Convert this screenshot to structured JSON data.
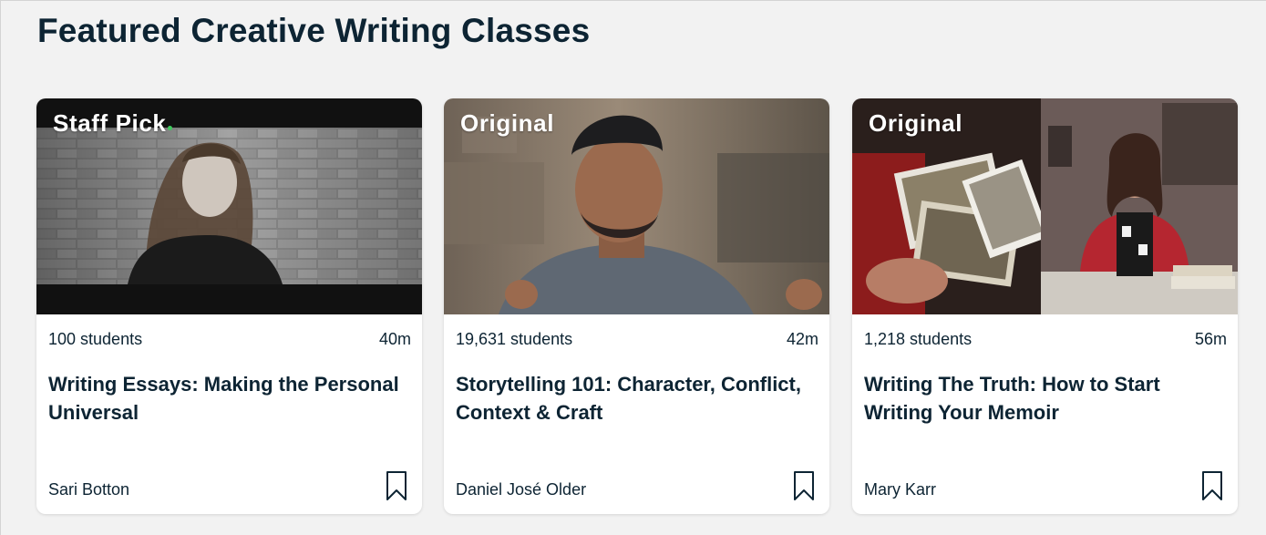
{
  "section": {
    "title": "Featured Creative Writing Classes"
  },
  "cards": [
    {
      "badge": "Staff Pick",
      "students": "100 students",
      "duration": "40m",
      "title": "Writing Essays: Making the Personal Universal",
      "instructor": "Sari Botton"
    },
    {
      "badge": "Original",
      "students": "19,631 students",
      "duration": "42m",
      "title": "Storytelling 101: Character, Conflict, Context & Craft",
      "instructor": "Daniel José Older"
    },
    {
      "badge": "Original",
      "students": "1,218 students",
      "duration": "56m",
      "title": "Writing The Truth: How to Start Writing Your Memoir",
      "instructor": "Mary Karr"
    }
  ],
  "icons": {
    "bookmark": "bookmark-icon"
  },
  "colors": {
    "text": "#0d2433",
    "accent_dot": "#3ec85c",
    "page_bg": "#f2f2f2",
    "card_bg": "#ffffff"
  }
}
